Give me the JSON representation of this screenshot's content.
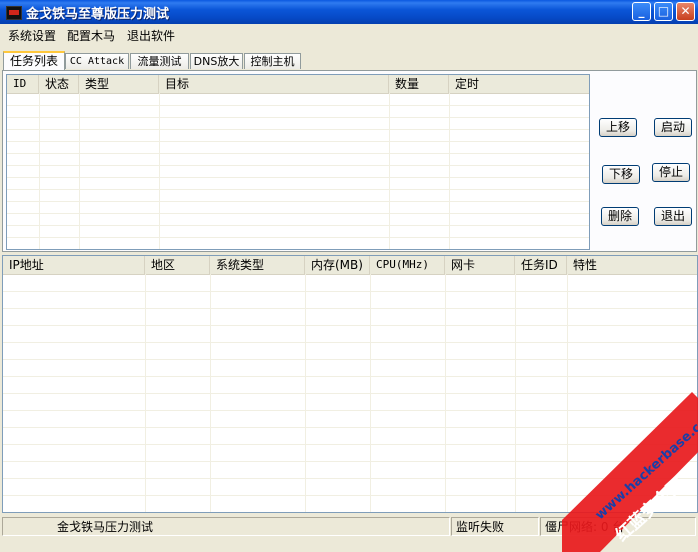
{
  "window": {
    "title": "金戈铁马至尊版压力测试",
    "minimize_glyph": "_",
    "maximize_glyph": "□",
    "close_glyph": "✕"
  },
  "menu": [
    "系统设置",
    "配置木马",
    "退出软件"
  ],
  "tabs": [
    "任务列表",
    "CC Attack",
    "流量测试",
    "DNS放大",
    "控制主机"
  ],
  "task_table": {
    "columns": [
      "ID",
      "状态",
      "类型",
      "目标",
      "数量",
      "定时"
    ]
  },
  "buttons": {
    "move_up": "上移",
    "start": "启动",
    "move_down": "下移",
    "stop": "停止",
    "delete": "删除",
    "exit": "退出"
  },
  "host_table": {
    "columns": [
      "IP地址",
      "地区",
      "系统类型",
      "内存(MB)",
      "CPU(MHz)",
      "网卡",
      "任务ID",
      "特性"
    ]
  },
  "status": {
    "app_name": "金戈铁马压力测试",
    "monitor": "监听失败",
    "bots": "僵尸网络: 0 台"
  },
  "watermark": {
    "url": "www.hackerbase.com",
    "name": "红蓝安全网"
  },
  "colors": {
    "titlebar": "#0A58E0",
    "tab_active_accent": "#FFC83C",
    "watermark": "#E8191C"
  }
}
